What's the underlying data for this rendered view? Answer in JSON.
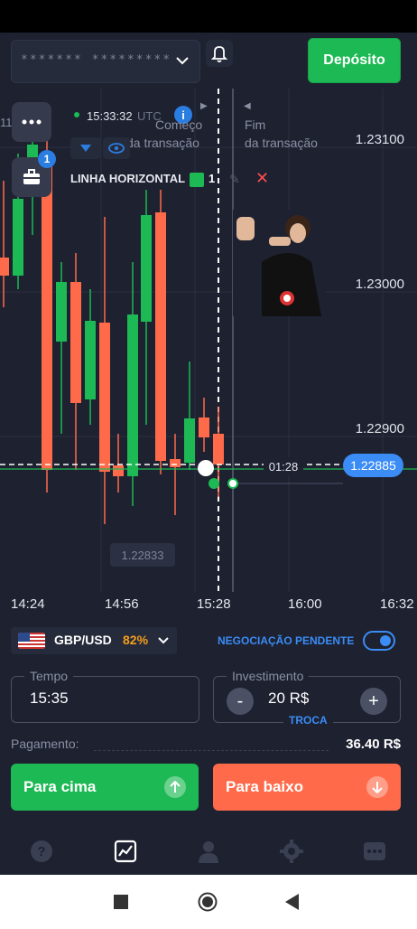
{
  "header": {
    "account_masked": "******* *********",
    "deposit_label": "Depósito"
  },
  "chart": {
    "clock": "15:33:32",
    "clock_tz": "UTC",
    "start_label_1": "Começo",
    "start_label_2": "da transação",
    "end_label_1": "Fim",
    "end_label_2": "da transação",
    "left_partial": "11",
    "tools_badge": "1",
    "horizontal_line_label": "LINHA HORIZONTAL",
    "horizontal_line_count": "1",
    "price_labels": [
      "1.23100",
      "1.23000",
      "1.22900"
    ],
    "current_price": "1.22885",
    "expiry_timer": "01:28",
    "min_price": "1.22833",
    "time_labels": [
      "14:24",
      "14:56",
      "15:28",
      "16:00",
      "16:32"
    ],
    "colors": {
      "up": "#1db954",
      "down": "#ff6b4a",
      "accent": "#3b8cf5"
    }
  },
  "controls": {
    "pair": "GBP/USD",
    "payout_percent": "82%",
    "pending_label": "NEGOCIAÇÃO PENDENTE",
    "time_label": "Tempo",
    "time_value": "15:35",
    "investment_label": "Investimento",
    "investment_value": "20 R$",
    "minus": "-",
    "plus": "+",
    "troca_label": "TROCA",
    "payout_label": "Pagamento:",
    "payout_value": "36.40 R$",
    "up_label": "Para cima",
    "down_label": "Para baixo"
  },
  "tabs": [
    "help-icon",
    "chart-icon",
    "profile-icon",
    "settings-icon",
    "more-icon"
  ]
}
